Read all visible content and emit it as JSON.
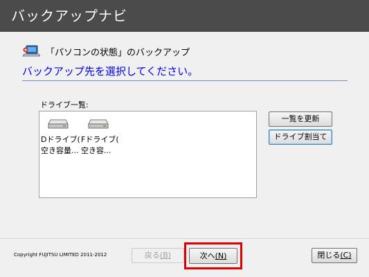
{
  "window": {
    "title": "バックアップナビ"
  },
  "heading": {
    "text": "「パソコンの状態」のバックアップ",
    "icon": "laptop-backup-icon"
  },
  "instruction": "バックアップ先を選択してください。",
  "drive_group": {
    "label": "ドライブ一覧:",
    "drives": [
      {
        "line1": "Dドライブ(",
        "line2": "空き容量...",
        "icon": "hard-drive-icon"
      },
      {
        "line1": "Fドライブ(",
        "line2": "空き容...",
        "icon": "hard-drive-icon"
      }
    ]
  },
  "side_buttons": {
    "refresh": "一覧を更新",
    "assign": "ドライブ割当て"
  },
  "footer": {
    "copyright": "Copyright FUJITSU LIMITED 2011-2012",
    "back_label": "戻る",
    "back_key": "(B)",
    "next_label": "次へ",
    "next_key": "(N)",
    "close_label": "閉じる",
    "close_key": "(C)"
  },
  "colors": {
    "titlebar": "#4b4b4b",
    "instruction": "#0000ee",
    "highlight": "#e00000"
  }
}
